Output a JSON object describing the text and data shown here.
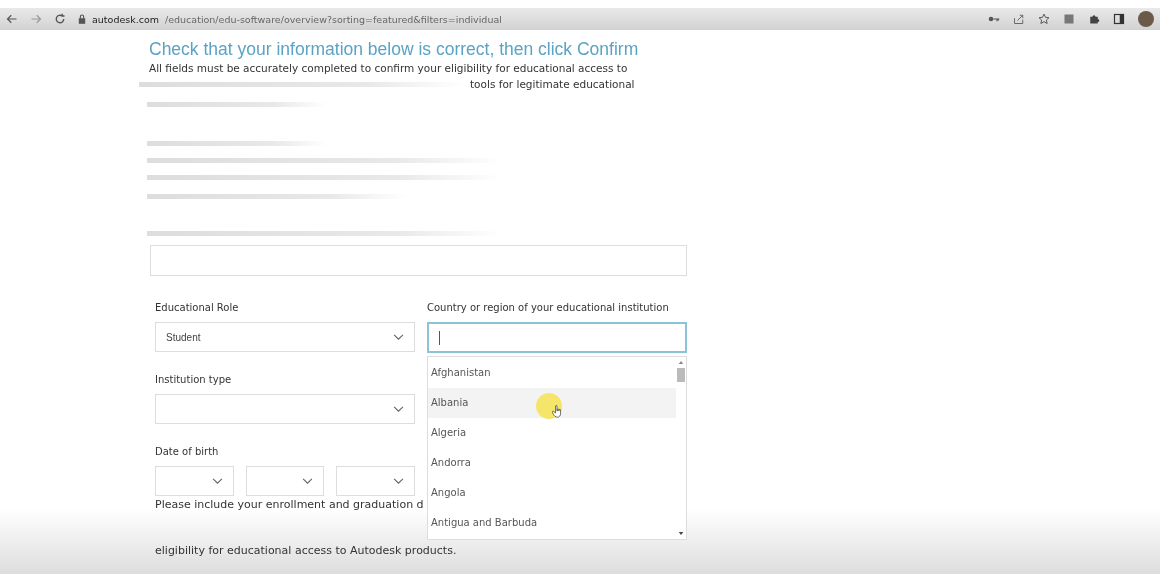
{
  "browser": {
    "url_host": "autodesk.com",
    "url_path": "/education/edu-software/overview?sorting=featured&filters=individual"
  },
  "title": "Check that your information below is correct, then click Confirm",
  "intro_lines": [
    "All fields must be accurately completed to confirm your eligibility for educational access to",
    "tools for legitimate educational"
  ],
  "fields": [
    {
      "label": "Educational Role",
      "value": "Student"
    },
    {
      "label": "Institution type"
    }
  ],
  "country": {
    "label": "Country or region of your educational institution",
    "focused": true,
    "options": [
      {
        "label": "Afghanistan",
        "selected": false
      },
      {
        "label": "Albania",
        "selected": true
      },
      {
        "label": "Algeria",
        "selected": false
      },
      {
        "label": "Andorra",
        "selected": false
      },
      {
        "label": "Angola",
        "selected": false
      },
      {
        "label": "Antigua and Barbuda",
        "selected": false
      }
    ]
  },
  "date_of_birth": {
    "label": "Date of birth"
  },
  "dates_note_lines": [
    "Please include your enrollment and graduation d",
    "eligibility for educational access to Autodesk products."
  ]
}
